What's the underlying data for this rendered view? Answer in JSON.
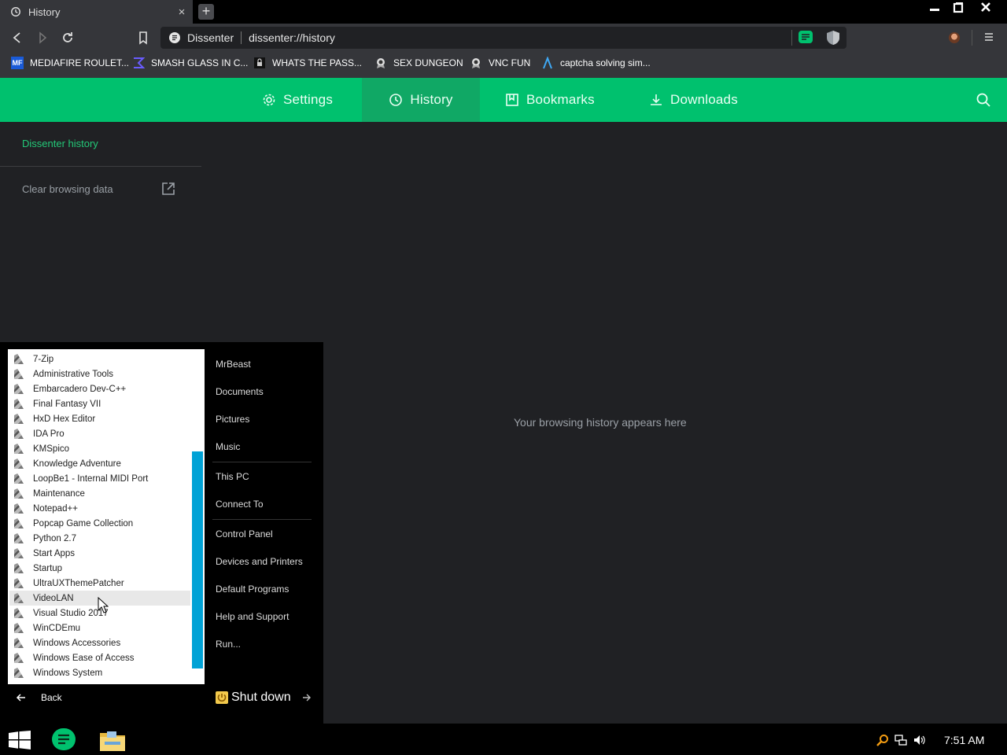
{
  "browser": {
    "tab_title": "History",
    "tab_close": "×",
    "new_tab": "+",
    "omnibox_site": "Dissenter",
    "omnibox_url": "dissenter://history"
  },
  "bookmarks": [
    {
      "label": "MEDIAFIRE ROULET...",
      "icon": "mediafire-icon",
      "icon_text": "MF"
    },
    {
      "label": "SMASH GLASS IN C...",
      "icon": "sigma-icon"
    },
    {
      "label": "WHATS THE PASS...",
      "icon": "lock-icon"
    },
    {
      "label": "SEX DUNGEON",
      "icon": "badge-icon"
    },
    {
      "label": "VNC FUN",
      "icon": "badge-icon"
    },
    {
      "label": "captcha solving sim...",
      "icon": "lambda-icon"
    }
  ],
  "header": {
    "tabs": {
      "settings": "Settings",
      "history": "History",
      "bookmarks": "Bookmarks",
      "downloads": "Downloads"
    }
  },
  "sidebar": {
    "history_title": "Dissenter history",
    "clear_data": "Clear browsing data"
  },
  "main": {
    "empty_message": "Your browsing history appears here"
  },
  "start_menu": {
    "apps": [
      "7-Zip",
      "Administrative Tools",
      "Embarcadero Dev-C++",
      "Final Fantasy VII",
      "HxD Hex Editor",
      "IDA Pro",
      "KMSpico",
      "Knowledge Adventure",
      "LoopBe1 - Internal MIDI Port",
      "Maintenance",
      "Notepad++",
      "Popcap Game Collection",
      "Python 2.7",
      "Start Apps",
      "Startup",
      "UltraUXThemePatcher",
      "VideoLAN",
      "Visual Studio 2017",
      "WinCDEmu",
      "Windows Accessories",
      "Windows Ease of Access",
      "Windows System"
    ],
    "hovered_app": "VideoLAN",
    "places": {
      "user": "MrBeast",
      "documents": "Documents",
      "pictures": "Pictures",
      "music": "Music",
      "this_pc": "This PC",
      "connect_to": "Connect To",
      "control_panel": "Control Panel",
      "devices_printers": "Devices and Printers",
      "default_programs": "Default Programs",
      "help_support": "Help and Support",
      "run": "Run..."
    },
    "back_label": "Back",
    "shutdown_label": "Shut down"
  },
  "taskbar": {
    "clock": "7:51 AM"
  },
  "colors": {
    "accent_green": "#00c16e",
    "active_tab_green": "#10a865",
    "scrollbar_blue": "#00a2d6"
  }
}
